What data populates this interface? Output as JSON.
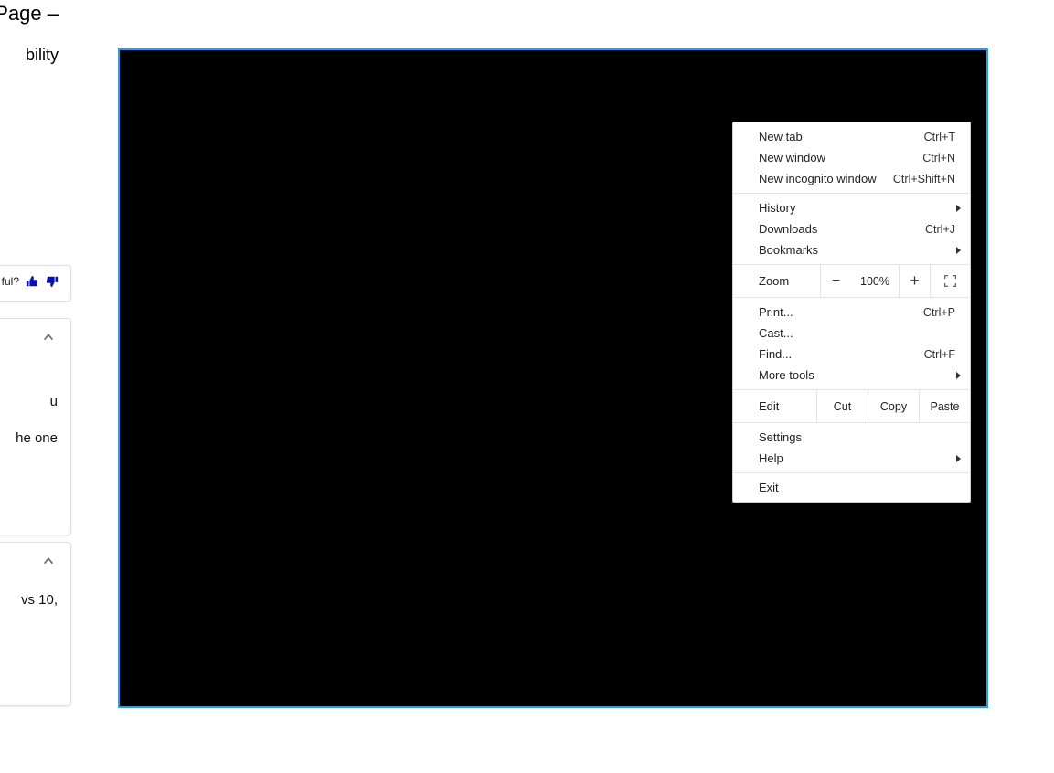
{
  "page": {
    "title_fragment": "Page –",
    "subtitle_fragment": "bility",
    "feedback_prompt": "ful?",
    "step1": {
      "line_a": "u",
      "line_b": "he one"
    },
    "step2": {
      "line_a": "vs 10,"
    }
  },
  "menu": {
    "new_tab": {
      "label": "New tab",
      "accel": "Ctrl+T"
    },
    "new_window": {
      "label": "New window",
      "accel": "Ctrl+N"
    },
    "new_incognito": {
      "label": "New incognito window",
      "accel": "Ctrl+Shift+N"
    },
    "history": {
      "label": "History"
    },
    "downloads": {
      "label": "Downloads",
      "accel": "Ctrl+J"
    },
    "bookmarks": {
      "label": "Bookmarks"
    },
    "zoom": {
      "label": "Zoom",
      "minus": "−",
      "pct": "100%",
      "plus": "+"
    },
    "print": {
      "label": "Print...",
      "accel": "Ctrl+P"
    },
    "cast": {
      "label": "Cast..."
    },
    "find": {
      "label": "Find...",
      "accel": "Ctrl+F"
    },
    "more_tools": {
      "label": "More tools"
    },
    "edit": {
      "label": "Edit",
      "cut": "Cut",
      "copy": "Copy",
      "paste": "Paste"
    },
    "settings": {
      "label": "Settings"
    },
    "help": {
      "label": "Help"
    },
    "exit": {
      "label": "Exit"
    }
  }
}
